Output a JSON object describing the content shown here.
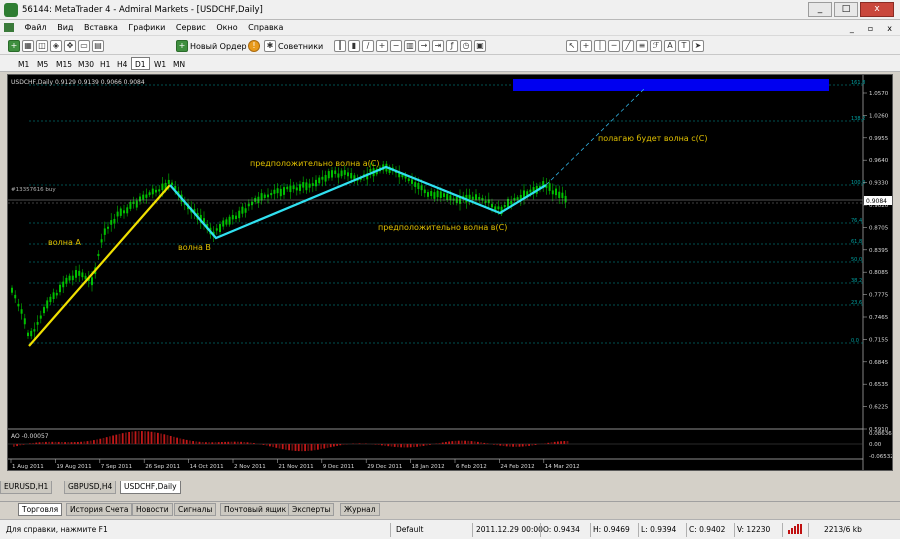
{
  "window": {
    "title": "56144: MetaTrader 4 - Admiral Markets - [USDCHF,Daily]",
    "buttons": [
      "_",
      "□",
      "x"
    ]
  },
  "menu": {
    "items": [
      "Файл",
      "Вид",
      "Вставка",
      "Графики",
      "Сервис",
      "Окно",
      "Справка"
    ],
    "mdi_buttons": [
      "_",
      "▫",
      "x"
    ]
  },
  "toolbar": {
    "new_order": "Новый Ордер",
    "advisors": "Советники"
  },
  "timeframes": [
    "M1",
    "M5",
    "M15",
    "M30",
    "H1",
    "H4",
    "D1",
    "W1",
    "MN"
  ],
  "timeframe_active": "D1",
  "chart": {
    "info": "USDCHF,Daily  0.9129 0.9139 0.9066 0.9084",
    "order_label": "#13357616 buy",
    "price_current": "0.9084",
    "price_axis": [
      "1.0570",
      "1.0260",
      "0.9955",
      "0.9640",
      "0.9330",
      "0.9020",
      "0.8705",
      "0.8395",
      "0.8085",
      "0.7775",
      "0.7465",
      "0.7155",
      "0.6845",
      "0.6535",
      "0.6225",
      "0.5910"
    ],
    "fib_levels": [
      "161.8",
      "138.2",
      "100.0",
      "76.4",
      "61.8",
      "50.0",
      "38.2",
      "23.6",
      "0.0"
    ],
    "annotations": {
      "wave_a": "волна А",
      "wave_b": "волна В",
      "wave_ac": "предположительно волна а(С)",
      "wave_bc": "предположительно волна в(С)",
      "wave_cc": "полагаю будет волна с(С)"
    },
    "ao_label": "AO -0.00057",
    "ao_axis": [
      "0.08636",
      "0.00",
      "-0.06532"
    ],
    "date_axis": [
      "1 Aug 2011",
      "19 Aug 2011",
      "7 Sep 2011",
      "26 Sep 2011",
      "14 Oct 2011",
      "2 Nov 2011",
      "21 Nov 2011",
      "9 Dec 2011",
      "29 Dec 2011",
      "18 Jan 2012",
      "6 Feb 2012",
      "24 Feb 2012",
      "14 Mar 2012"
    ]
  },
  "symbol_tabs": [
    "EURUSD,H1",
    "GBPUSD,H4",
    "USDCHF,Daily"
  ],
  "symbol_tab_active": "USDCHF,Daily",
  "terminal_tabs": [
    "Торговля",
    "История Счета",
    "Новости",
    "Сигналы",
    "Почтовый ящик",
    "Эксперты",
    "Журнал"
  ],
  "terminal_tab_active": "Торговля",
  "status": {
    "help": "Для справки, нажмите F1",
    "profile": "Default",
    "datetime": "2011.12.29 00:00",
    "open": "O: 0.9434",
    "high": "H: 0.9469",
    "low": "L: 0.9394",
    "close": "C: 0.9402",
    "volume": "V: 12230",
    "traffic": "2213/6 kb"
  },
  "colors": {
    "candle": "#00c000",
    "fib": "#00a0a0",
    "wave_yellow": "#f0e000",
    "wave_cyan": "#30e0f0",
    "label_yellow": "#e0c000",
    "target_blue": "#0000f0"
  }
}
